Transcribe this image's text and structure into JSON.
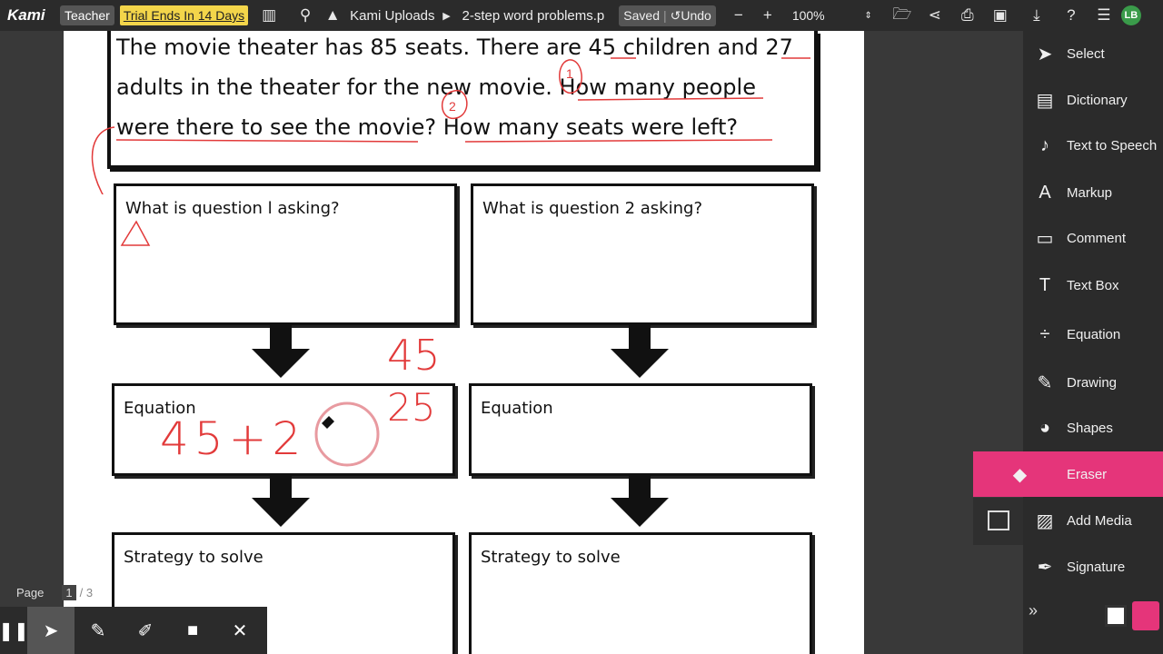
{
  "app": {
    "logo": "Kami",
    "role": "Teacher",
    "trial": "Trial Ends In 14 Days"
  },
  "breadcrumb": {
    "folder": "Kami Uploads",
    "file": "2-step word problems.p"
  },
  "status": {
    "saved": "Saved",
    "undo": "Undo"
  },
  "zoom": {
    "value": "100%"
  },
  "user": {
    "initials": "LB"
  },
  "document": {
    "problem_lines": [
      "The movie theater has 85 seats.  There are 45 children and 27",
      "adults in the theater for the new movie.  How many people",
      "were there to see the movie?  How many seats were left?"
    ],
    "q1": "What is question l asking?",
    "q2": "What is question 2 asking?",
    "eq1": "Equation",
    "eq2": "Equation",
    "strat1": "Strategy to solve",
    "strat2": "Strategy to solve"
  },
  "annotations": {
    "num45": "45",
    "num25": "25",
    "eq_written": "45+2",
    "mark1": "1",
    "mark2": "2"
  },
  "tools": [
    {
      "label": "Select",
      "icon": "cursor-icon"
    },
    {
      "label": "Dictionary",
      "icon": "book-icon"
    },
    {
      "label": "Text to Speech",
      "icon": "speech-icon"
    },
    {
      "label": "Markup",
      "icon": "markup-icon"
    },
    {
      "label": "Comment",
      "icon": "comment-icon"
    },
    {
      "label": "Text Box",
      "icon": "text-icon"
    },
    {
      "label": "Equation",
      "icon": "divide-icon"
    },
    {
      "label": "Drawing",
      "icon": "brush-icon"
    },
    {
      "label": "Shapes",
      "icon": "shapes-icon"
    },
    {
      "label": "Eraser",
      "icon": "eraser-icon"
    },
    {
      "label": "Add Media",
      "icon": "media-icon"
    },
    {
      "label": "Signature",
      "icon": "pen-icon"
    }
  ],
  "page": {
    "label": "Page",
    "current": "1",
    "total": "/ 3"
  },
  "colors": {
    "accent": "#e5357a",
    "ink": "#e23a3a",
    "trial": "#f3d54a"
  }
}
